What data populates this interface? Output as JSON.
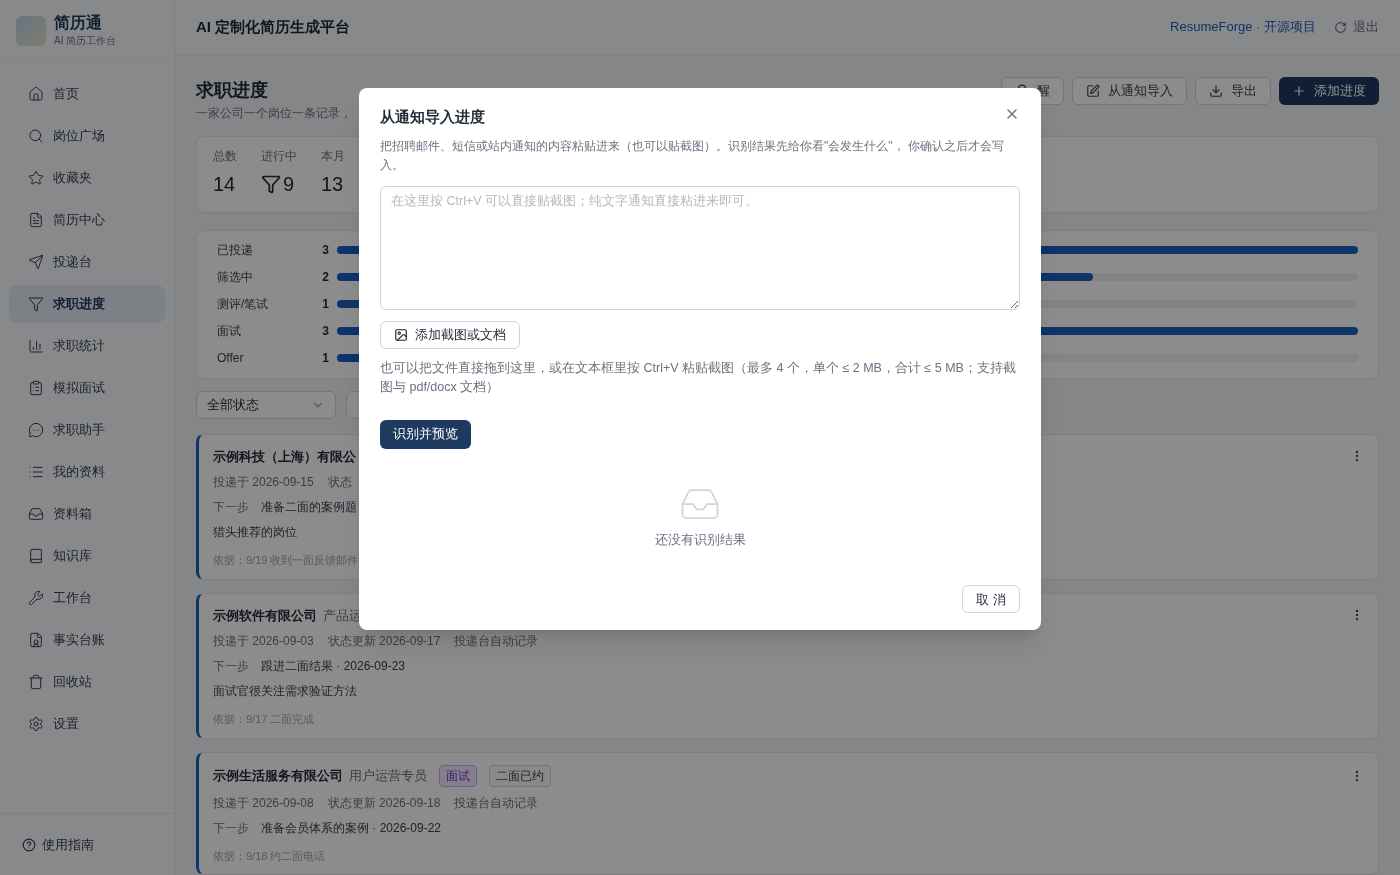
{
  "brand": {
    "title": "简历通",
    "subtitle": "AI 简历工作台"
  },
  "header": {
    "title": "AI 定制化简历生成平台",
    "link": "ResumeForge · 开源项目",
    "logout": "退出"
  },
  "sidebar": {
    "items": [
      {
        "label": "首页",
        "selected": false
      },
      {
        "label": "岗位广场",
        "selected": false
      },
      {
        "label": "收藏夹",
        "selected": false
      },
      {
        "label": "简历中心",
        "selected": false
      },
      {
        "label": "投递台",
        "selected": false
      },
      {
        "label": "求职进度",
        "selected": true
      },
      {
        "label": "求职统计",
        "selected": false
      },
      {
        "label": "模拟面试",
        "selected": false
      },
      {
        "label": "求职助手",
        "selected": false
      },
      {
        "label": "我的资料",
        "selected": false
      },
      {
        "label": "资料箱",
        "selected": false
      },
      {
        "label": "知识库",
        "selected": false
      },
      {
        "label": "工作台",
        "selected": false
      },
      {
        "label": "事实台账",
        "selected": false
      },
      {
        "label": "回收站",
        "selected": false
      },
      {
        "label": "设置",
        "selected": false
      }
    ],
    "help": "使用指南"
  },
  "page": {
    "title": "求职进度",
    "subtitle": "一家公司一个岗位一条记录，",
    "actions": [
      {
        "label": "醒",
        "kind": "outline"
      },
      {
        "label": "从通知导入",
        "kind": "outline"
      },
      {
        "label": "导出",
        "kind": "outline"
      },
      {
        "label": "添加进度",
        "kind": "primary"
      }
    ],
    "stats": [
      {
        "label": "总数",
        "value": "14",
        "kind": "plain"
      },
      {
        "label": "进行中",
        "value": "9",
        "kind": "funnel"
      },
      {
        "label": "本月",
        "value": "13",
        "kind": "plain"
      }
    ],
    "status_bars": [
      {
        "label": "已投递",
        "count": "3",
        "level": 1
      },
      {
        "label": "筛选中",
        "count": "2",
        "level": 0.74
      },
      {
        "label": "测评/笔试",
        "count": "1",
        "level": 0.37
      },
      {
        "label": "面试",
        "count": "3",
        "level": 1
      },
      {
        "label": "Offer",
        "count": "1",
        "level": 0.37
      }
    ],
    "filter": {
      "value": "全部状态"
    }
  },
  "cards": [
    {
      "company": "示例科技（上海）有限公",
      "meta": [
        "投递于 2026-09-15",
        "状态"
      ],
      "next_label": "下一步",
      "next_value": "准备二面的案例题",
      "note": "猎头推荐的岗位",
      "basis": "依据：9/19 收到一面反馈邮件"
    },
    {
      "company": "示例软件有限公司",
      "role": "产品运",
      "meta": [
        "投递于 2026-09-03",
        "状态更新 2026-09-17",
        "投递台自动记录"
      ],
      "next_label": "下一步",
      "next_value": "跟进二面结果 · 2026-09-23",
      "note": "面试官很关注需求验证方法",
      "basis": "依据：9/17 二面完成"
    },
    {
      "company": "示例生活服务有限公司",
      "role": "用户运营专员",
      "tags": [
        {
          "label": "面试",
          "kind": "stage"
        },
        {
          "label": "二面已约",
          "kind": "plain"
        }
      ],
      "meta": [
        "投递于 2026-09-08",
        "状态更新 2026-09-18",
        "投递台自动记录"
      ],
      "next_label": "下一步",
      "next_value": "准备会员体系的案例 · 2026-09-22",
      "basis": "依据：9/18 约二面电话"
    }
  ],
  "dialog": {
    "title": "从通知导入进度",
    "description": "把招聘邮件、短信或站内通知的内容粘贴进来（也可以贴截图）。识别结果先给你看\"会发生什么\"， 你确认之后才会写入。",
    "placeholder": "在这里按 Ctrl+V 可以直接贴截图；纯文字通知直接粘进来即可。",
    "attach": "添加截图或文档",
    "hint": "也可以把文件直接拖到这里，或在文本框里按 Ctrl+V 粘贴截图（最多 4 个，单个 ≤ 2 MB，合计 ≤ 5 MB；支持截图与 pdf/docx 文档）",
    "submit": "识别并预览",
    "empty": "还没有识别结果",
    "cancel": "取 消"
  }
}
